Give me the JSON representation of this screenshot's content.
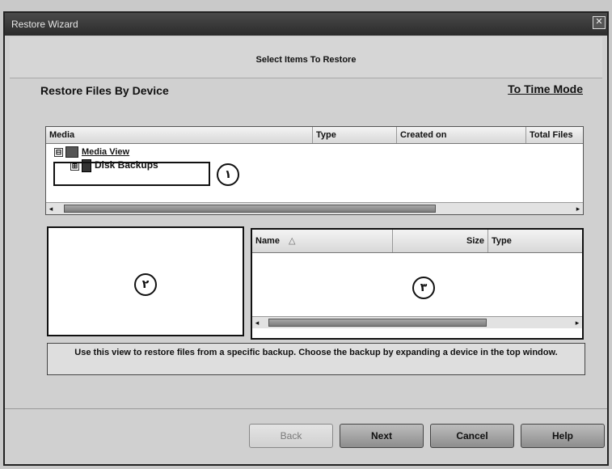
{
  "window": {
    "title": "Restore Wizard",
    "close_glyph": "✕"
  },
  "header": {
    "step_title": "Select Items To Restore"
  },
  "main": {
    "section_title": "Restore Files By Device",
    "mode_link": "To Time Mode",
    "media_grid": {
      "columns": [
        "Media",
        "Type",
        "Created on",
        "Total Files"
      ],
      "tree": [
        {
          "label": "Media View",
          "expander": "⊟"
        },
        {
          "label": "Disk Backups",
          "expander": "⊞"
        }
      ]
    },
    "markers": {
      "one": "١",
      "two": "٢",
      "three": "٣"
    },
    "file_grid": {
      "columns": [
        "Name",
        "Size",
        "Type"
      ],
      "sort_indicator": "△"
    },
    "info_text": "Use this view to restore files from a specific backup. Choose the backup by expanding a device in the top window."
  },
  "footer": {
    "back_label": "Back",
    "next_label": "Next",
    "cancel_label": "Cancel",
    "help_label": "Help"
  },
  "icons": {
    "scroll_left": "◂",
    "scroll_right": "▸"
  }
}
